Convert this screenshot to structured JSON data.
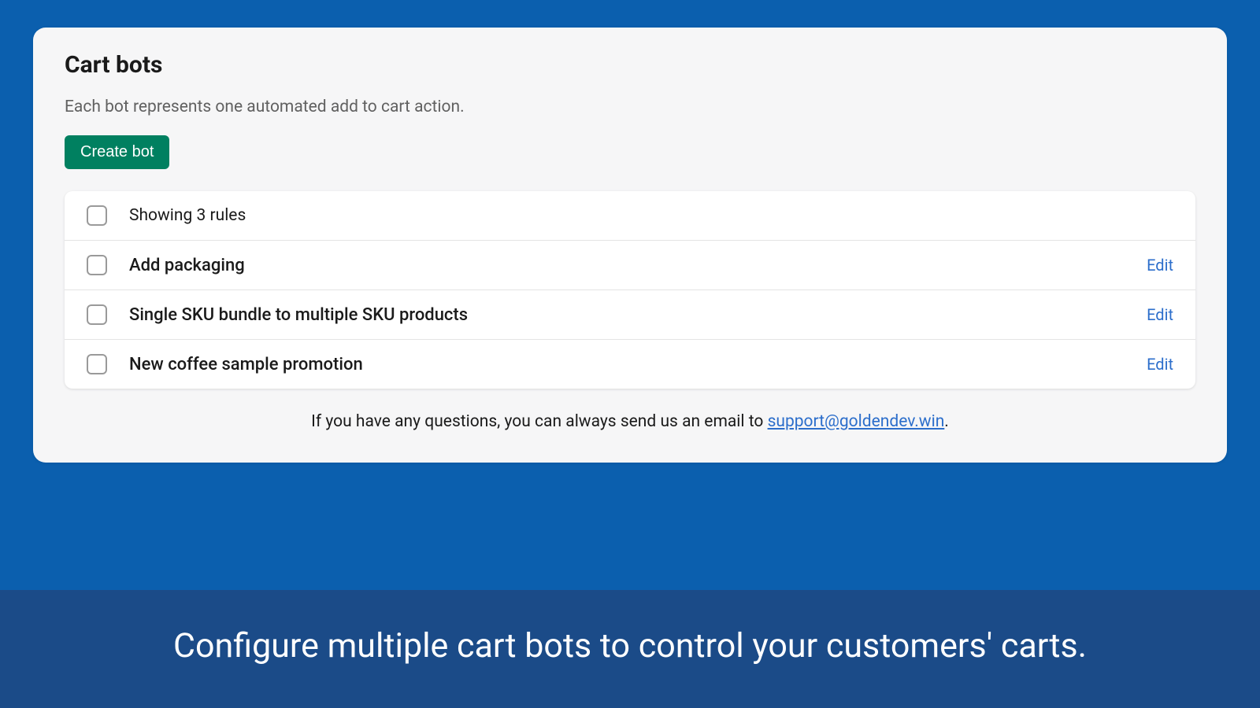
{
  "header": {
    "title": "Cart bots",
    "description": "Each bot represents one automated add to cart action.",
    "create_button": "Create bot"
  },
  "list": {
    "header_text": "Showing 3 rules",
    "edit_label": "Edit",
    "rows": [
      {
        "title": "Add packaging"
      },
      {
        "title": "Single SKU bundle to multiple SKU products"
      },
      {
        "title": "New coffee sample promotion"
      }
    ]
  },
  "footer": {
    "prefix": "If you have any questions, you can always send us an email to ",
    "email": "support@goldendev.win",
    "suffix": "."
  },
  "banner": {
    "text": "Configure multiple cart bots to control your customers' carts."
  }
}
